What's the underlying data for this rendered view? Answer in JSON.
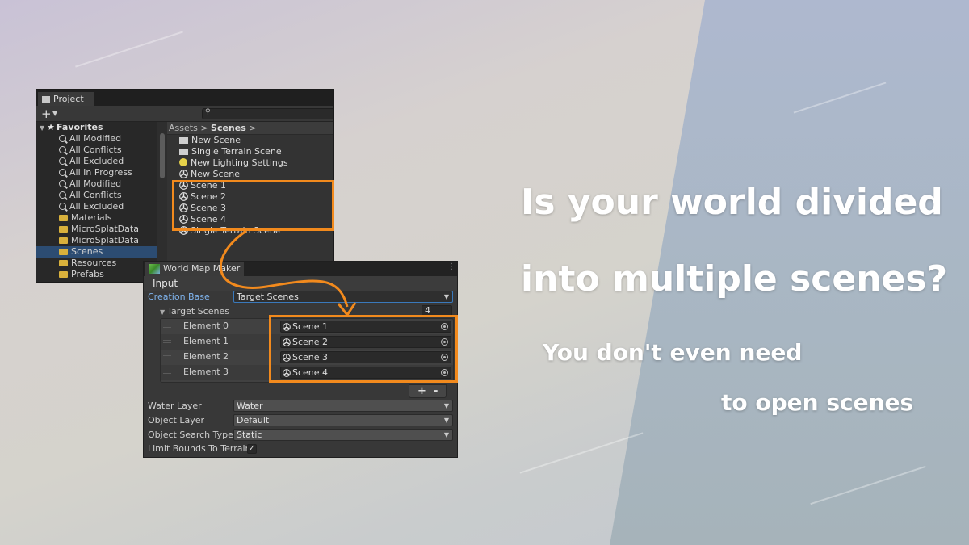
{
  "project_panel": {
    "tab_label": "Project",
    "toolbar": {
      "add_icon": "plus-icon",
      "search_icon": "search-icon"
    },
    "favorites": {
      "header": "Favorites",
      "items": [
        "All Modified",
        "All Conflicts",
        "All Excluded",
        "All In Progress",
        "All Modified",
        "All Conflicts",
        "All Excluded"
      ]
    },
    "folders": [
      "Materials",
      "MicroSplatData",
      "MicroSplatData",
      "Scenes",
      "Resources",
      "Prefabs"
    ],
    "selected_folder": "Scenes",
    "breadcrumb": {
      "root": "Assets",
      "sep": ">",
      "current": "Scenes",
      "trail": ">"
    },
    "assets": [
      {
        "name": "New Scene",
        "icon": "folder-icon"
      },
      {
        "name": "Single Terrain Scene",
        "icon": "folder-icon"
      },
      {
        "name": "New Lighting Settings",
        "icon": "lighting-settings-icon"
      },
      {
        "name": "New Scene",
        "icon": "unity-scene-icon"
      },
      {
        "name": "Scene 1",
        "icon": "unity-scene-icon"
      },
      {
        "name": "Scene 2",
        "icon": "unity-scene-icon"
      },
      {
        "name": "Scene 3",
        "icon": "unity-scene-icon"
      },
      {
        "name": "Scene 4",
        "icon": "unity-scene-icon"
      },
      {
        "name": "Single Terrain Scene",
        "icon": "unity-scene-icon"
      }
    ]
  },
  "inspector": {
    "tab_label": "World Map Maker",
    "section_title": "Input",
    "creation_base": {
      "label": "Creation Base",
      "value": "Target Scenes"
    },
    "target_scenes": {
      "label": "Target Scenes",
      "count": "4",
      "elements": [
        {
          "label": "Element 0",
          "value": "Scene 1"
        },
        {
          "label": "Element 1",
          "value": "Scene 2"
        },
        {
          "label": "Element 2",
          "value": "Scene 3"
        },
        {
          "label": "Element 3",
          "value": "Scene 4"
        }
      ],
      "add_label": "+",
      "remove_label": "-"
    },
    "water_layer": {
      "label": "Water Layer",
      "value": "Water"
    },
    "object_layer": {
      "label": "Object Layer",
      "value": "Default"
    },
    "object_search_type": {
      "label": "Object Search Type",
      "value": "Static"
    },
    "limit_bounds": {
      "label": "Limit Bounds To Terrain",
      "checked": "✓"
    }
  },
  "headline": {
    "line1": "Is your world divided",
    "line2": "into multiple scenes?",
    "line3": "You don't even need",
    "line4": "to open scenes"
  },
  "colors": {
    "highlight": "#f28a1d",
    "selection": "#2c4c72",
    "label_blue": "#7fb4ee"
  }
}
